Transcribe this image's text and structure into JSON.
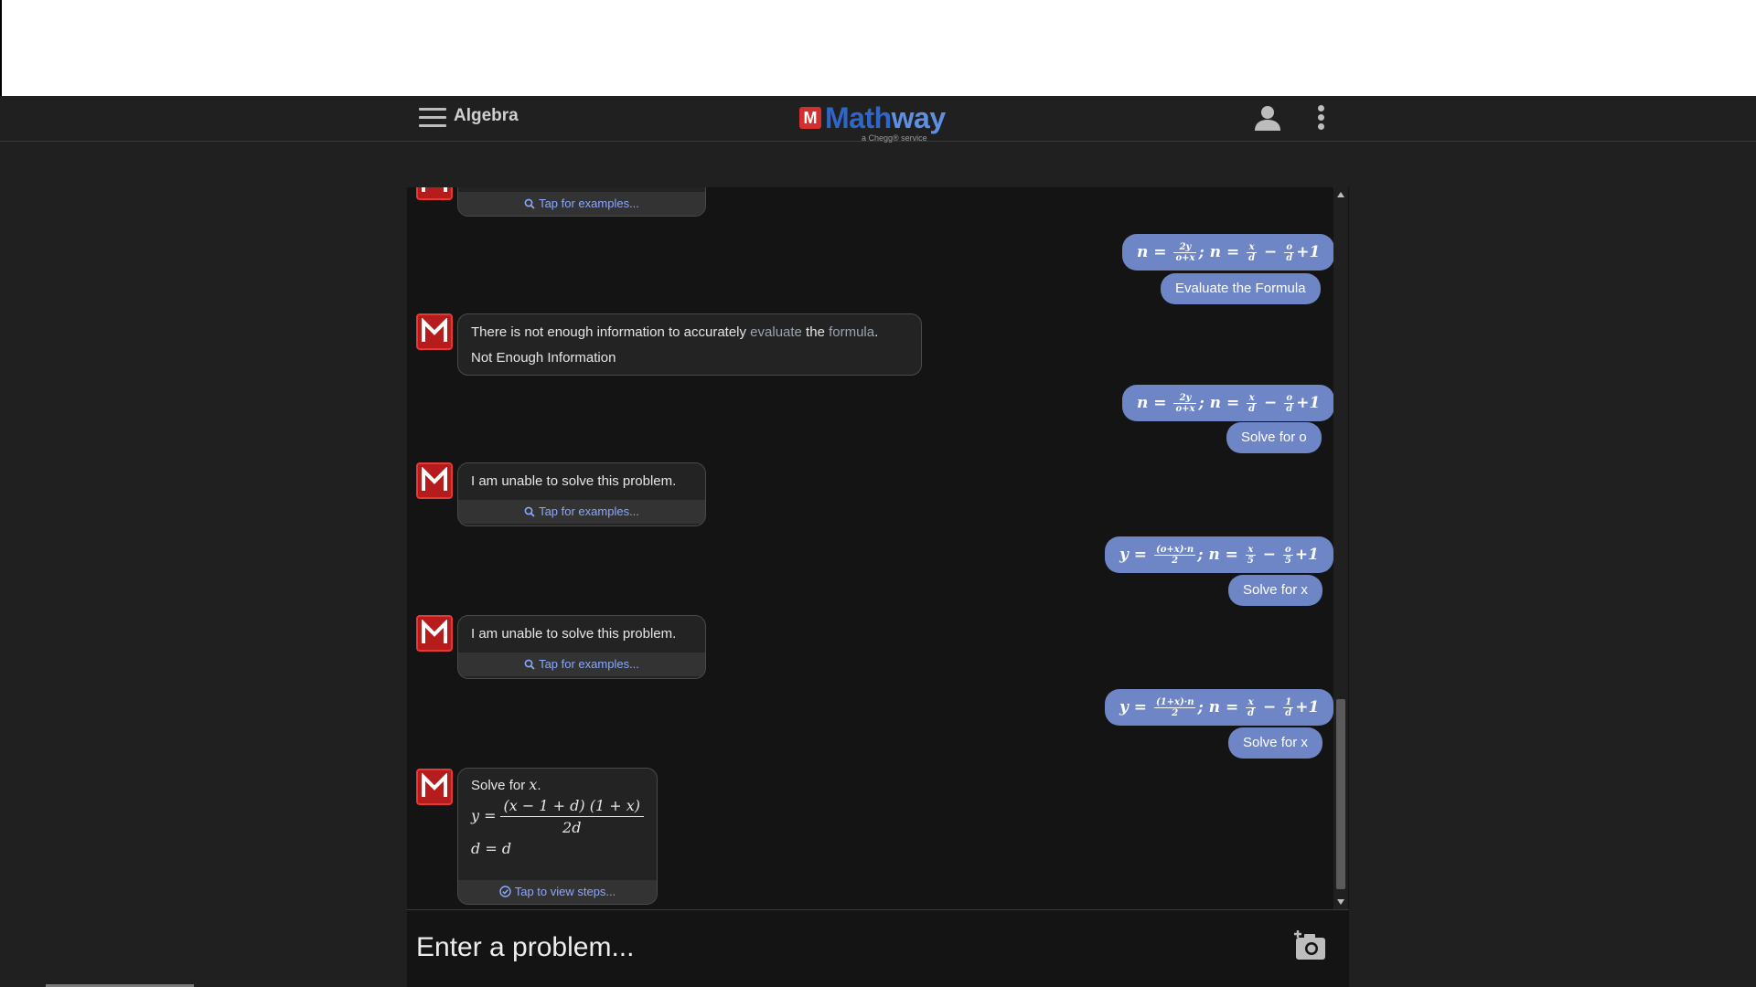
{
  "header": {
    "subject": "Algebra",
    "logo_text_a": "Math",
    "logo_text_b": "way",
    "logo_badge": "M",
    "logo_sub": "a Chegg® service"
  },
  "messages": {
    "top_tap": "Tap for examples...",
    "u1_label": "Evaluate the Formula",
    "b1_line1_a": "There is not enough information to accurately ",
    "b1_line1_link1": "evaluate",
    "b1_line1_b": " the ",
    "b1_line1_link2": "formula",
    "b1_line1_c": ".",
    "b1_line2": "Not Enough Information",
    "u2_label": "Solve for o",
    "b2_text": "I am unable to solve this problem.",
    "b2_tap": "Tap for examples...",
    "u3_label": "Solve for x",
    "b3_text": "I am unable to solve this problem.",
    "b3_tap": "Tap for examples...",
    "u4_label": "Solve for x",
    "b4_title_a": "Solve for ",
    "b4_title_var": "x",
    "b4_title_b": ".",
    "b4_lhs": "y =",
    "b4_num": "(x − 1 + d) (1 + x)",
    "b4_den": "2d",
    "b4_line3": "d = d",
    "b4_tap": "Tap to view steps..."
  },
  "equations": {
    "e1": {
      "a": "n =",
      "f1n": "2y",
      "f1d": "o+x",
      "b": "; n =",
      "f2n": "x",
      "f2d": "d",
      "c": "−",
      "f3n": "o",
      "f3d": "d",
      "d": "+1"
    },
    "e2": {
      "a": "n =",
      "f1n": "2y",
      "f1d": "o+x",
      "b": "; n =",
      "f2n": "x",
      "f2d": "d",
      "c": "−",
      "f3n": "o",
      "f3d": "d",
      "d": "+1"
    },
    "e3": {
      "a": "y =",
      "f1n": "(o+x)·n",
      "f1d": "2",
      "b": "; n =",
      "f2n": "x",
      "f2d": "5",
      "c": "−",
      "f3n": "o",
      "f3d": "5",
      "d": "+1"
    },
    "e4": {
      "a": "y =",
      "f1n": "(1+x)·n",
      "f1d": "2",
      "b": "; n =",
      "f2n": "x",
      "f2d": "d",
      "c": "−",
      "f3n": "1",
      "f3d": "d",
      "d": "+1"
    }
  },
  "input": {
    "placeholder": "Enter a problem..."
  },
  "colors": {
    "user_bubble": "#6f86c6",
    "bot_bubble": "#232323",
    "link": "#8aa8ff",
    "brand_red": "#d32f2f",
    "brand_blue": "#2f66c9"
  },
  "icons": [
    "menu-icon",
    "mathway-logo",
    "user-icon",
    "more-vert-icon",
    "search-icon",
    "check-circle-icon",
    "camera-icon"
  ]
}
